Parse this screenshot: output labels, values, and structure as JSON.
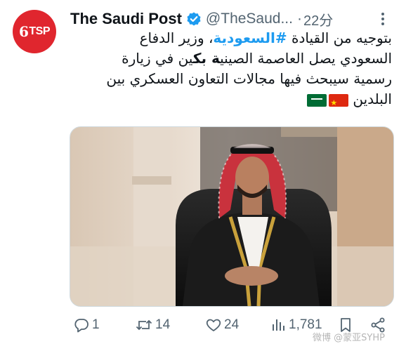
{
  "account": {
    "avatar_text": "TSP",
    "display_name": "The Saudi Post",
    "handle": "@TheSaud...",
    "separator": "·",
    "time": "22分"
  },
  "tweet": {
    "line1_part1": "بتوجيه من القيادة ",
    "hashtag": "#السعودية",
    "line1_part2": "، وزير الدفاع",
    "line2_part1": "السعودي يصل العاصمة الصيني",
    "line2_bold": "ة بك",
    "line2_part2": "ين في زيارة",
    "line3": "رسمية سيبحث فيها مجالات التعاون العسكري بين",
    "line4": "البلدين"
  },
  "media": {
    "alt": "Photo"
  },
  "actions": {
    "replies": "1",
    "reposts": "14",
    "likes": "24",
    "views": "1,781"
  },
  "watermark": "微博 @蒙亚SYHP",
  "colors": {
    "accent": "#1d9bf0",
    "muted": "#536471",
    "avatar_bg": "#e0262e"
  }
}
